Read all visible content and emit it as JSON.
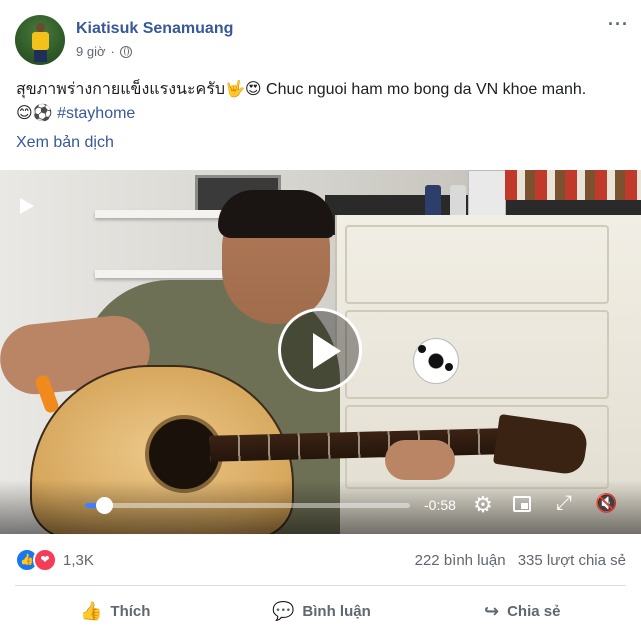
{
  "post": {
    "author": "Kiatisuk Senamuang",
    "time": "9 giờ",
    "separator": "·",
    "privacy_icon": "globe-icon",
    "more_icon": "more-dots-icon",
    "text_line1": "สุขภาพร่างกายแข็งแรงนะครับ🤟😍 Chuc nguoi ham mo bong da VN khoe manh.",
    "text_line2_emoji": "😊⚽",
    "hashtag": "#stayhome",
    "translate_label": "Xem bản dịch"
  },
  "video": {
    "play_icon": "play-icon",
    "time_remaining": "-0:58",
    "progress": 0.06
  },
  "reactions": {
    "count": "1,3K",
    "comments": "222 bình luận",
    "shares": "335 lượt chia sẻ"
  },
  "actions": {
    "like": "Thích",
    "comment": "Bình luận",
    "share": "Chia sẻ"
  }
}
